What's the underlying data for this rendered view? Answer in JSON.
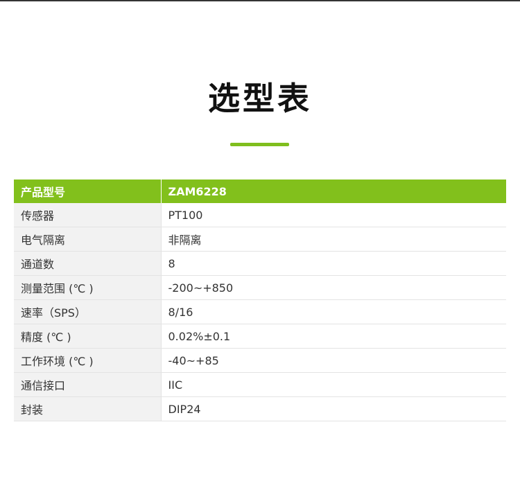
{
  "title": "选型表",
  "colors": {
    "accent": "#82c01c",
    "underline": "#7fbe1e",
    "key_background": "#f2f2f2"
  },
  "table": {
    "header": {
      "label": "产品型号",
      "value": "ZAM6228"
    },
    "rows": [
      {
        "label": "传感器",
        "value": "PT100"
      },
      {
        "label": "电气隔离",
        "value": "非隔离"
      },
      {
        "label": "通道数",
        "value": "8"
      },
      {
        "label": "测量范围 (℃ )",
        "value": "-200~+850"
      },
      {
        "label": "速率（SPS）",
        "value": "8/16"
      },
      {
        "label": "精度 (℃ )",
        "value": "0.02%±0.1"
      },
      {
        "label": "工作环境 (℃ )",
        "value": "-40~+85"
      },
      {
        "label": "通信接口",
        "value": "IIC"
      },
      {
        "label": "封装",
        "value": "DIP24"
      }
    ]
  }
}
